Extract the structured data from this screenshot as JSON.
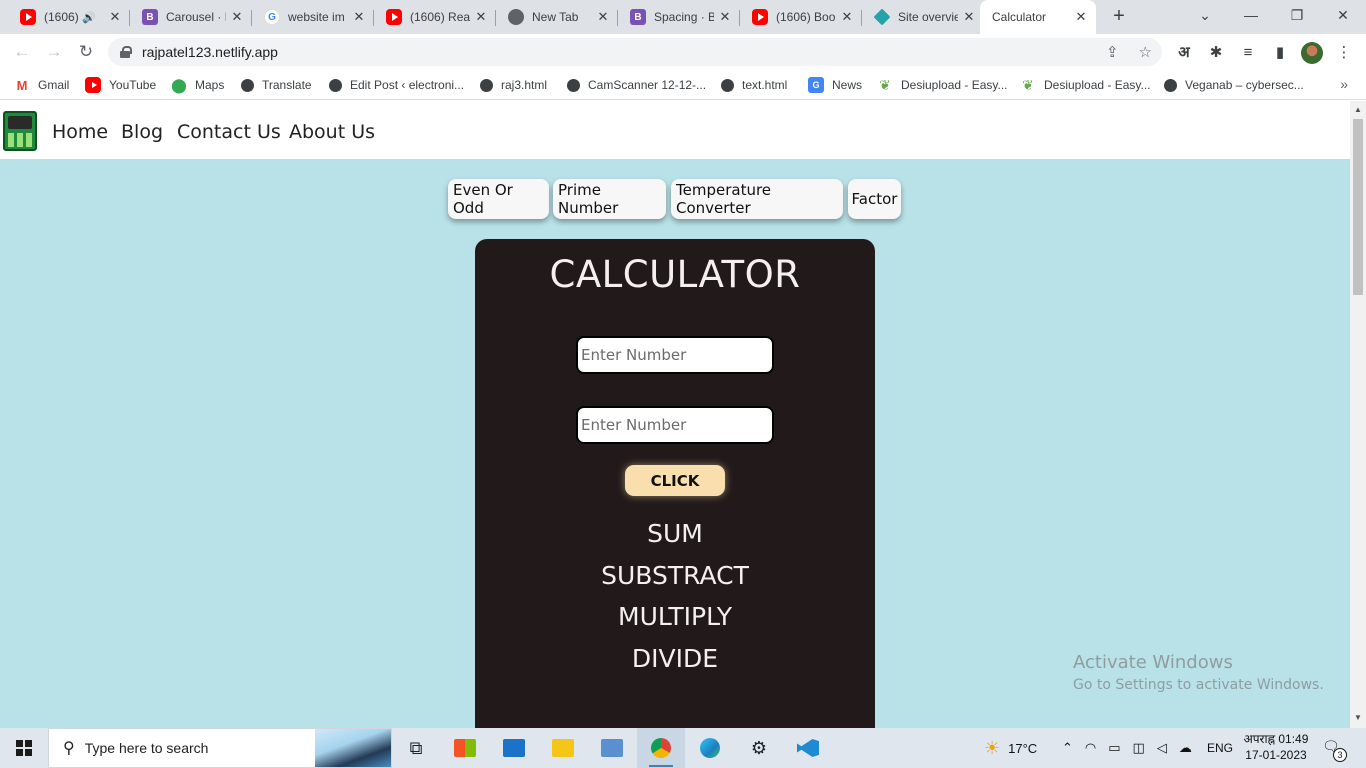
{
  "browser": {
    "tabs": [
      {
        "title": "(1606)",
        "icon": "youtube-icon",
        "kind": "yt",
        "audio": true
      },
      {
        "title": "Carousel · B",
        "icon": "bootstrap-icon",
        "kind": "bs"
      },
      {
        "title": "website im",
        "icon": "google-icon",
        "kind": "g"
      },
      {
        "title": "(1606) Rea",
        "icon": "youtube-icon",
        "kind": "yt"
      },
      {
        "title": "New Tab",
        "icon": "chrome-icon",
        "kind": "chrome"
      },
      {
        "title": "Spacing · B",
        "icon": "bootstrap-icon",
        "kind": "bs"
      },
      {
        "title": "(1606) Boo",
        "icon": "youtube-icon",
        "kind": "yt"
      },
      {
        "title": "Site overvie",
        "icon": "netlify-icon",
        "kind": "netlify"
      },
      {
        "title": "Calculator",
        "icon": "calculator-favicon-icon",
        "kind": "calc",
        "active": true
      }
    ],
    "url": "rajpatel123.netlify.app",
    "bookmarks": [
      {
        "label": "Gmail",
        "icon": "gmail-icon"
      },
      {
        "label": "YouTube",
        "icon": "youtube-icon"
      },
      {
        "label": "Maps",
        "icon": "maps-icon"
      },
      {
        "label": "Translate",
        "icon": "globe-icon"
      },
      {
        "label": "Edit Post ‹ electroni...",
        "icon": "globe-icon"
      },
      {
        "label": "raj3.html",
        "icon": "globe-icon"
      },
      {
        "label": "CamScanner 12-12-...",
        "icon": "globe-icon"
      },
      {
        "label": "text.html",
        "icon": "globe-icon"
      },
      {
        "label": "News",
        "icon": "news-icon"
      },
      {
        "label": "Desiupload - Easy...",
        "icon": "leaf-icon"
      },
      {
        "label": "Desiupload - Easy...",
        "icon": "leaf-icon"
      },
      {
        "label": "Veganab – cybersec...",
        "icon": "globe-icon"
      }
    ],
    "lang_button": "अ"
  },
  "site": {
    "nav": [
      "Home",
      "Blog",
      "Contact Us",
      "About Us"
    ],
    "tools": [
      "Even Or Odd",
      "Prime Number",
      "Temperature Converter",
      "Factor"
    ],
    "calculator": {
      "title": "CALCULATOR",
      "input1_placeholder": "Enter Number",
      "input2_placeholder": "Enter Number",
      "button": "CLICK",
      "ops": [
        "SUM",
        "SUBSTRACT",
        "MULTIPLY",
        "DIVIDE"
      ]
    }
  },
  "watermark": {
    "line1": "Activate Windows",
    "line2": "Go to Settings to activate Windows."
  },
  "taskbar": {
    "search_placeholder": "Type here to search",
    "weather": "17°C",
    "language": "ENG",
    "time": "अपराह्न 01:49",
    "date": "17-01-2023",
    "notifications": "3"
  },
  "colors": {
    "page_bg": "#b9e2e8",
    "calc_bg": "#221a1a",
    "click_button": "#f9dfae"
  }
}
